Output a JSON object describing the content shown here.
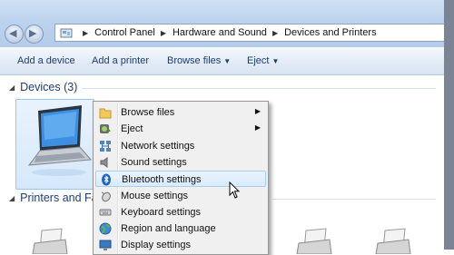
{
  "window": {
    "breadcrumb": [
      "Control Panel",
      "Hardware and Sound",
      "Devices and Printers"
    ]
  },
  "toolbar": {
    "add_device": "Add a device",
    "add_printer": "Add a printer",
    "browse_files": "Browse files",
    "eject": "Eject"
  },
  "groups": {
    "devices": "Devices (3)",
    "printers": "Printers and Fa"
  },
  "context_menu": {
    "items": [
      {
        "label": "Browse files",
        "icon": "folder-icon",
        "submenu": true
      },
      {
        "label": "Eject",
        "icon": "eject-icon",
        "submenu": true
      },
      {
        "label": "Network settings",
        "icon": "network-icon",
        "submenu": false
      },
      {
        "label": "Sound settings",
        "icon": "speaker-icon",
        "submenu": false
      },
      {
        "label": "Bluetooth settings",
        "icon": "bluetooth-icon",
        "submenu": false,
        "highlighted": true
      },
      {
        "label": "Mouse settings",
        "icon": "mouse-icon",
        "submenu": false
      },
      {
        "label": "Keyboard settings",
        "icon": "keyboard-icon",
        "submenu": false
      },
      {
        "label": "Region and language",
        "icon": "globe-icon",
        "submenu": false
      },
      {
        "label": "Display settings",
        "icon": "display-icon",
        "submenu": false
      }
    ]
  },
  "colors": {
    "link_blue": "#1a3e6e",
    "header_blue": "#1e3c78",
    "highlight": "#d9ebfc"
  }
}
